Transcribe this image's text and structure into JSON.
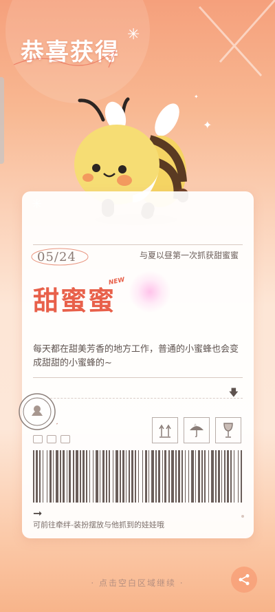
{
  "header": {
    "title": "恭喜获得"
  },
  "card": {
    "date": "05/24",
    "origin": "与夏以昼第一次抓获甜蜜蜜",
    "item_name": "甜蜜蜜",
    "new_badge": "NEW",
    "description": "每天都在甜美芳香的地方工作，普通的小蜜蜂也会变成甜甜的小蜜蜂的~",
    "hint": "可前往牵绊-装扮摆放与他抓到的娃娃哦"
  },
  "footer": {
    "continue_text": "· 点击空白区域继续 ·"
  },
  "icons": {
    "share": "share-icon",
    "arrow_down": "arrow-down-icon",
    "arrow_right": "arrow-right-icon",
    "this_way_up": "this-way-up-icon",
    "keep_dry": "umbrella-icon",
    "fragile": "fragile-glass-icon"
  },
  "colors": {
    "accent": "#e8604a",
    "background_top": "#f5a07c",
    "share_button": "#f8a078"
  }
}
